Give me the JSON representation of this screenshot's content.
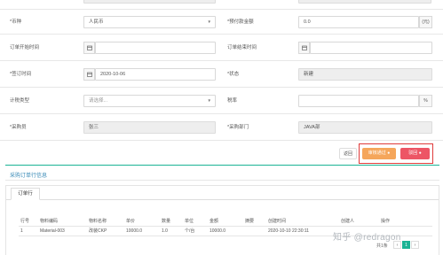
{
  "form": {
    "currency_label": "*币种",
    "currency_value": "人民币",
    "prepay_label": "*预付款金额",
    "prepay_value": "0.0",
    "prepay_unit": "(元)",
    "order_start_label": "订单开始时间",
    "order_end_label": "订单结束时间",
    "sign_time_label": "*签订时间",
    "sign_time_value": "2020-10-06",
    "status_label": "*状态",
    "status_value": "新建",
    "plan_type_label": "计税类型",
    "plan_type_placeholder": "请选择...",
    "tax_label": "税率",
    "tax_unit": "%",
    "buyer_label": "*采购员",
    "buyer_value": "张三",
    "dept_label": "*采购部门",
    "dept_value": "JAVA部"
  },
  "actions": {
    "back_label": "返回",
    "submit_label": "审核通过",
    "reject_label": "驳回"
  },
  "section": {
    "title": "采购订单行信息",
    "tab_label": "订单行"
  },
  "table": {
    "headers": [
      "行号",
      "物料编码",
      "物料名称",
      "单价",
      "数量",
      "单位",
      "金额",
      "摘要",
      "创建时间",
      "创建人",
      "操作"
    ],
    "rows": [
      [
        "1",
        "Material-003",
        "改装CKP",
        "10000.0",
        "1.0",
        "个/台",
        "10000.0",
        "",
        "2020-10-10 22:30:11",
        "",
        ""
      ]
    ]
  },
  "pager": {
    "summary": "共1条",
    "prev": "‹",
    "page": "1",
    "next": "›"
  },
  "watermark": "知乎 @redragon",
  "colors": {
    "submit": "#f5a65b",
    "reject": "#ed5565",
    "accent": "#1ab394",
    "highlight_box": "#e03b3b"
  }
}
